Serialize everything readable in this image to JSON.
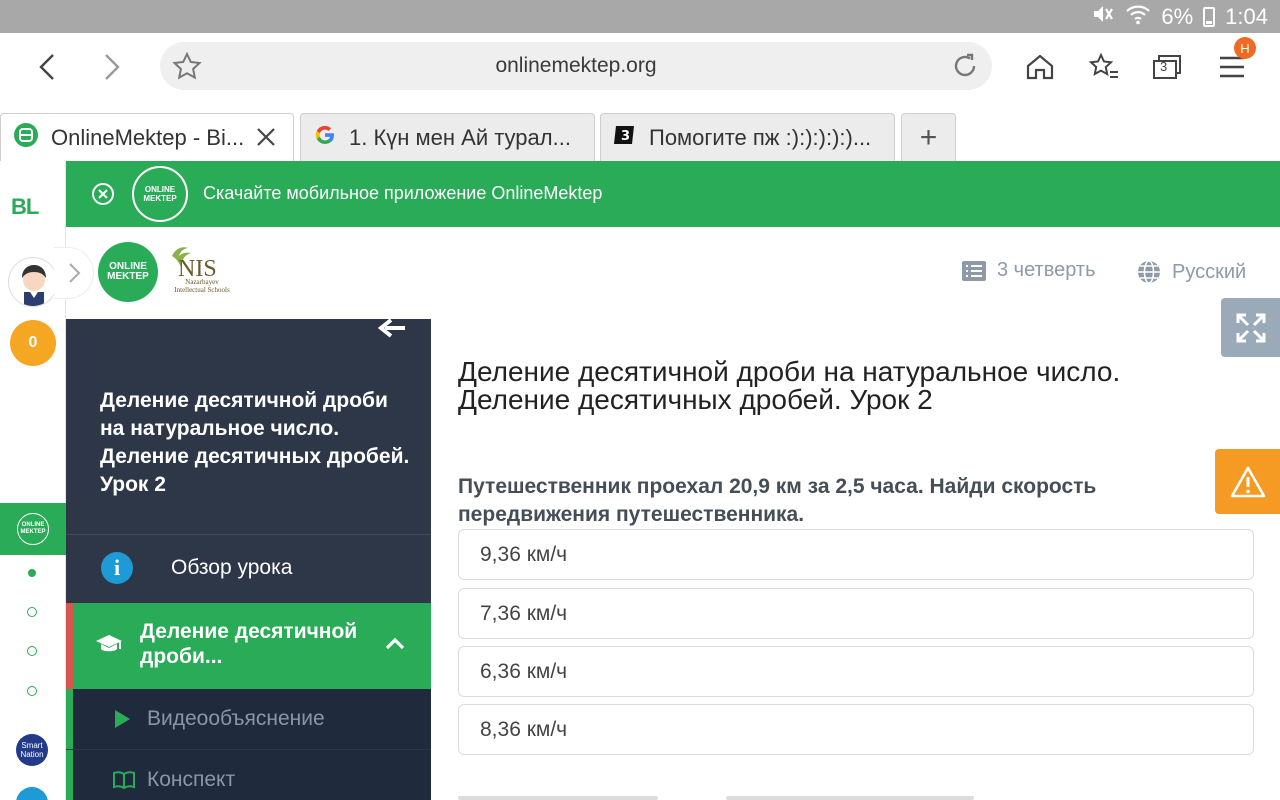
{
  "status": {
    "battery": "6%",
    "time": "1:04"
  },
  "browser": {
    "url": "onlinemektep.org",
    "tab_count": "3",
    "menu_badge": "Н",
    "tabs": [
      {
        "label": "OnlineMektep - Bi..."
      },
      {
        "label": "1. Күн мен Ай турал..."
      },
      {
        "label": "Помогите пж :):):):):)..."
      }
    ],
    "new_tab": "+"
  },
  "banner": {
    "text": "Скачайте мобильное приложение OnlineMektep",
    "logo_text": "ONLINE MEKTEP"
  },
  "rail": {
    "brand": "BL",
    "points": "0",
    "mini_logo": "ONLINE MEKTEP",
    "smart": "Smart Nation"
  },
  "header": {
    "logo_text": "ONLINE MEKTEP",
    "nis_big": "NIS",
    "nis_small": "Nazarbayev Intellectual Schools",
    "quarter": "3 четверть",
    "language": "Русский"
  },
  "sidebar": {
    "lesson_title": "Деление десятичной дроби на натуральное число. Деление десятичных дробей. Урок 2",
    "overview": "Обзор урока",
    "section": "Деление десятичной дроби...",
    "sub_items": [
      {
        "label": "Видеообъяснение"
      },
      {
        "label": "Конспект"
      }
    ]
  },
  "main": {
    "title_line1": "Деление десятичной дроби на натуральное число.",
    "title_line2": "Деление десятичных дробей. Урок 2",
    "question": "Путешественник проехал 20,9 км за 2,5 часа. Найди скорость передвижения путешественника.",
    "options": [
      {
        "text": "9,36 км/ч"
      },
      {
        "text": "7,36 км/ч"
      },
      {
        "text": "6,36 км/ч"
      },
      {
        "text": "8,36 км/ч"
      }
    ]
  },
  "colors": {
    "green": "#2aab57",
    "sidebar": "#2d3748",
    "warning": "#f59b23",
    "info": "#1e9ad6"
  }
}
